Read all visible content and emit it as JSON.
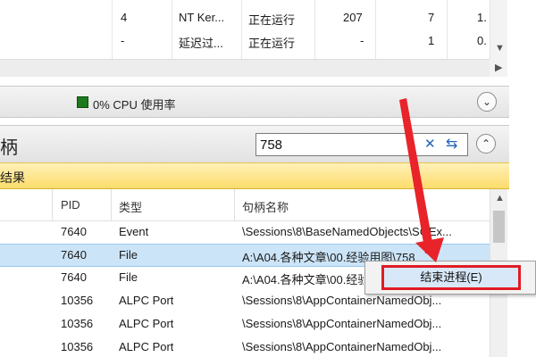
{
  "process_rows": [
    {
      "pid": "4",
      "description": "NT Ker...",
      "status": "正在运行",
      "threads": "207",
      "handles": "7",
      "cpu": "1."
    },
    {
      "pid": "-",
      "description": "延迟过...",
      "status": "正在运行",
      "threads": "-",
      "handles": "1",
      "cpu": "0."
    }
  ],
  "cpu_header": {
    "label": "0% CPU 使用率"
  },
  "handle_panel": {
    "title": "柄",
    "search_value": "758",
    "result_label": "结果"
  },
  "handle_columns": {
    "pid": "PID",
    "type": "类型",
    "name": "句柄名称"
  },
  "handle_rows": [
    {
      "pid": "7640",
      "type": "Event",
      "name": "\\Sessions\\8\\BaseNamedObjects\\SGEx..."
    },
    {
      "pid": "7640",
      "type": "File",
      "name": "A:\\A04.各种文章\\00.经验用图\\758"
    },
    {
      "pid": "7640",
      "type": "File",
      "name": "A:\\A04.各种文章\\00.经验..."
    },
    {
      "pid": "10356",
      "type": "ALPC Port",
      "name": "\\Sessions\\8\\AppContainerNamedObj..."
    },
    {
      "pid": "10356",
      "type": "ALPC Port",
      "name": "\\Sessions\\8\\AppContainerNamedObj..."
    },
    {
      "pid": "10356",
      "type": "ALPC Port",
      "name": "\\Sessions\\8\\AppContainerNamedObj..."
    }
  ],
  "context_menu": {
    "end_process": "结束进程(E)"
  },
  "icons": {
    "clear": "close-icon",
    "refresh": "refresh-icon",
    "collapse": "chevron-up-icon",
    "expand": "chevron-down-icon",
    "cpu_indicator": "cpu-indicator-icon"
  },
  "colors": {
    "cpu_indicator": "#1c7a1c",
    "highlight": "#e01b24",
    "selection": "#cce4f7",
    "banner": "#fddc6b",
    "search_icons": "#2163b5"
  }
}
